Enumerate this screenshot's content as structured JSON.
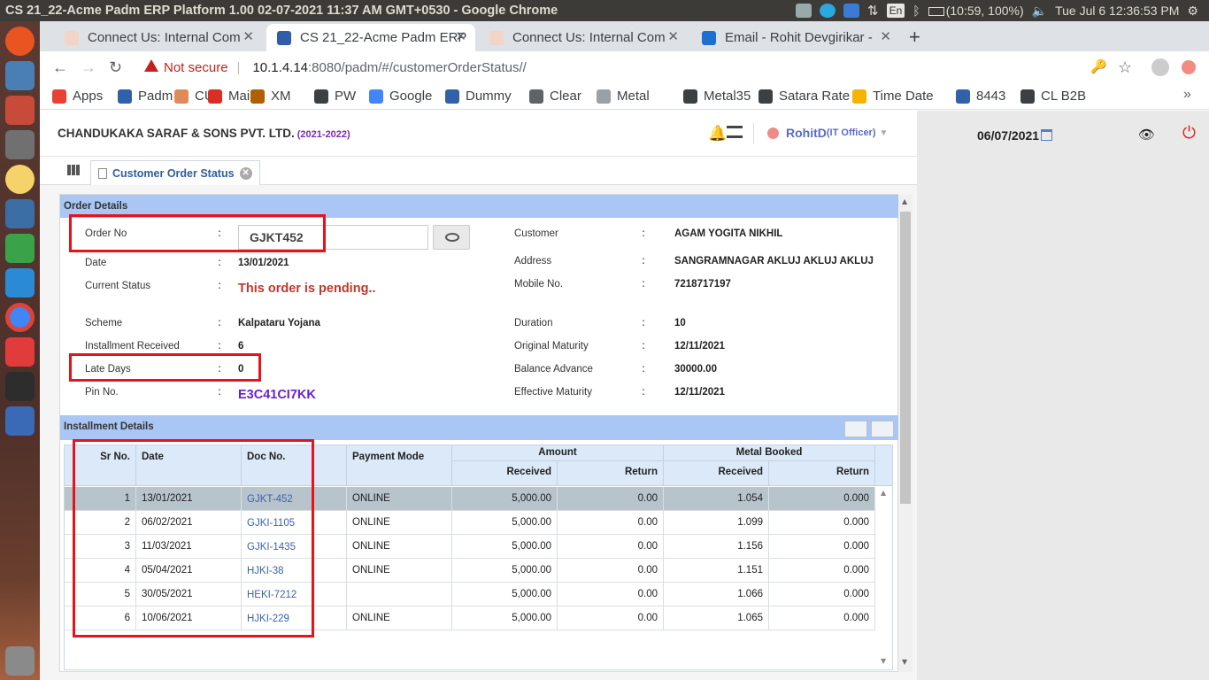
{
  "window": {
    "title": "CS 21_22-Acme Padm ERP Platform 1.00 02-07-2021 11:37 AM GMT+0530 - Google Chrome"
  },
  "tray": {
    "lang": "En",
    "battery": "(10:59, 100%)",
    "clock": "Tue Jul  6 12:36:53 PM"
  },
  "tabs": [
    {
      "label": "Connect Us: Internal Com",
      "color": "#f3d5c8"
    },
    {
      "label": "CS 21_22-Acme Padm ERP",
      "color": "#2f5ea8"
    },
    {
      "label": "Connect Us: Internal Com",
      "color": "#f3d5c8"
    },
    {
      "label": "Email - Rohit Devgirikar - ",
      "color": "#1f6fd1"
    }
  ],
  "address": {
    "security": "Not secure",
    "host": "10.1.4.14",
    "path": ":8080/padm/#/customerOrderStatus//"
  },
  "bookmarks": [
    {
      "label": "Apps",
      "color": "#e94235"
    },
    {
      "label": "Padm",
      "color": "#3161a8"
    },
    {
      "label": "CU",
      "color": "#e08a5a"
    },
    {
      "label": "Mail",
      "color": "#d93025"
    },
    {
      "label": "XM",
      "color": "#b06000"
    },
    {
      "label": "PW",
      "color": "#3c4043"
    },
    {
      "label": "Google",
      "color": "#4285f4"
    },
    {
      "label": "Dummy",
      "color": "#3161a8"
    },
    {
      "label": "Clear",
      "color": "#5f6368"
    },
    {
      "label": "Metal",
      "color": "#9aa0a6"
    },
    {
      "label": "Metal35",
      "color": "#3c4043"
    },
    {
      "label": "Satara Rate",
      "color": "#3c4043"
    },
    {
      "label": "Time Date",
      "color": "#f4b400"
    },
    {
      "label": "8443",
      "color": "#3161a8"
    },
    {
      "label": "CL B2B",
      "color": "#3c4043"
    }
  ],
  "header": {
    "company": "CHANDUKAKA SARAF & SONS PVT. LTD.",
    "year": "(2021-2022)",
    "user": "RohitD",
    "role": "(IT Officer)",
    "date": "06/07/2021"
  },
  "pagetab": {
    "label": "Customer Order Status"
  },
  "order": {
    "section_title": "Order Details",
    "left": [
      {
        "label": "Order No",
        "value": "GJKT452"
      },
      {
        "label": "Date",
        "value": "13/01/2021"
      },
      {
        "label": "Current Status",
        "value": "This order is pending.."
      },
      {
        "label": "Scheme",
        "value": "Kalpataru Yojana"
      },
      {
        "label": "Installment Received",
        "value": "6"
      },
      {
        "label": "Late Days",
        "value": "0"
      },
      {
        "label": "Pin No.",
        "value": "E3C41CI7KK"
      }
    ],
    "right": [
      {
        "label": "Customer",
        "value": "AGAM YOGITA NIKHIL"
      },
      {
        "label": "Address",
        "value": "SANGRAMNAGAR AKLUJ AKLUJ AKLUJ"
      },
      {
        "label": "Mobile No.",
        "value": "7218717197"
      },
      {
        "label": "Duration",
        "value": "10"
      },
      {
        "label": "Original Maturity",
        "value": "12/11/2021"
      },
      {
        "label": "Balance Advance",
        "value": "30000.00"
      },
      {
        "label": "Effective Maturity",
        "value": "12/11/2021"
      }
    ]
  },
  "installments": {
    "section_title": "Installment Details",
    "headers": {
      "sr": "Sr No.",
      "date": "Date",
      "doc": "Doc No.",
      "mode": "Payment Mode",
      "amount": "Amount",
      "metal": "Metal Booked",
      "received": "Received",
      "return": "Return"
    },
    "rows": [
      {
        "sr": "1",
        "date": "13/01/2021",
        "doc": "GJKT-452",
        "mode": "ONLINE",
        "amt_rec": "5,000.00",
        "amt_ret": "0.00",
        "met_rec": "1.054",
        "met_ret": "0.000"
      },
      {
        "sr": "2",
        "date": "06/02/2021",
        "doc": "GJKI-1105",
        "mode": "ONLINE",
        "amt_rec": "5,000.00",
        "amt_ret": "0.00",
        "met_rec": "1.099",
        "met_ret": "0.000"
      },
      {
        "sr": "3",
        "date": "11/03/2021",
        "doc": "GJKI-1435",
        "mode": "ONLINE",
        "amt_rec": "5,000.00",
        "amt_ret": "0.00",
        "met_rec": "1.156",
        "met_ret": "0.000"
      },
      {
        "sr": "4",
        "date": "05/04/2021",
        "doc": "HJKI-38",
        "mode": "ONLINE",
        "amt_rec": "5,000.00",
        "amt_ret": "0.00",
        "met_rec": "1.151",
        "met_ret": "0.000"
      },
      {
        "sr": "5",
        "date": "30/05/2021",
        "doc": "HEKI-7212",
        "mode": "",
        "amt_rec": "5,000.00",
        "amt_ret": "0.00",
        "met_rec": "1.066",
        "met_ret": "0.000"
      },
      {
        "sr": "6",
        "date": "10/06/2021",
        "doc": "HJKI-229",
        "mode": "ONLINE",
        "amt_rec": "5,000.00",
        "amt_ret": "0.00",
        "met_rec": "1.065",
        "met_ret": "0.000"
      }
    ]
  },
  "colors": {
    "status_red": "#c0392b",
    "pin_purple": "#6a1fd0",
    "section_blue": "#a9c6f5",
    "highlight_red": "#e8121b"
  }
}
